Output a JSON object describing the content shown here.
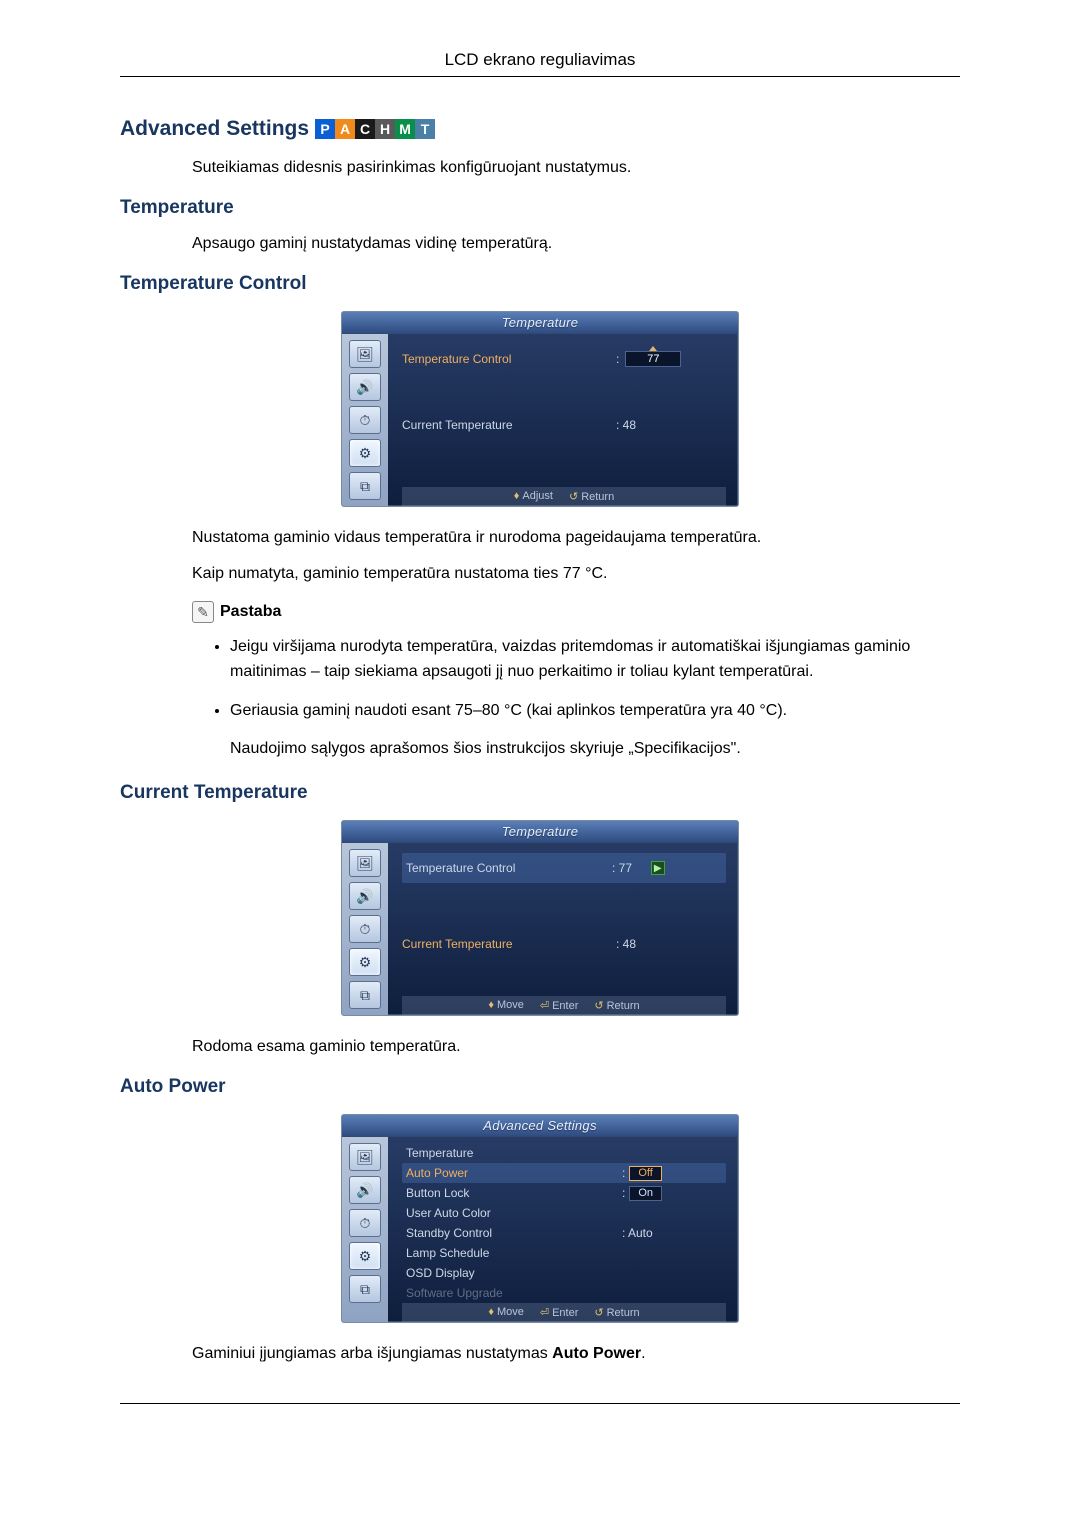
{
  "page_header": "LCD ekrano reguliavimas",
  "adv_heading": "Advanced Settings",
  "mode_chips": {
    "p": "P",
    "a": "A",
    "c": "C",
    "h": "H",
    "m": "M",
    "t": "T"
  },
  "adv_desc": "Suteikiamas didesnis pasirinkimas konfigūruojant nustatymus.",
  "temp_heading": "Temperature",
  "temp_desc": "Apsaugo gaminį nustatydamas vidinę temperatūrą.",
  "temp_ctrl_heading": "Temperature Control",
  "osd1": {
    "title": "Temperature",
    "row1_label": "Temperature Control",
    "row1_value": "77",
    "row2_label": "Current Temperature",
    "row2_value": ": 48",
    "foot_adjust": "Adjust",
    "foot_return": "Return"
  },
  "temp_ctrl_para1": "Nustatoma gaminio vidaus temperatūra ir nurodoma pageidaujama temperatūra.",
  "temp_ctrl_para2": "Kaip numatyta, gaminio temperatūra nustatoma ties 77 °C.",
  "note_label": "Pastaba",
  "bullet1": "Jeigu viršijama nurodyta temperatūra, vaizdas pritemdomas ir automatiškai išjungiamas gaminio maitinimas – taip siekiama apsaugoti jį nuo perkaitimo ir toliau kylant temperatūrai.",
  "bullet2": "Geriausia gaminį naudoti esant 75–80 °C (kai aplinkos temperatūra yra 40 °C).",
  "bullet2_sub": "Naudojimo sąlygos aprašomos šios instrukcijos skyriuje „Specifikacijos\".",
  "curr_temp_heading": "Current Temperature",
  "osd2": {
    "title": "Temperature",
    "row1_label": "Temperature Control",
    "row1_value": ": 77",
    "row2_label": "Current Temperature",
    "row2_value": ": 48",
    "foot_move": "Move",
    "foot_enter": "Enter",
    "foot_return": "Return"
  },
  "curr_temp_para": "Rodoma esama gaminio temperatūra.",
  "auto_power_heading": "Auto Power",
  "osd3": {
    "title": "Advanced Settings",
    "items": [
      {
        "label": "Temperature",
        "value": ""
      },
      {
        "label": "Auto Power",
        "value": "Off",
        "hl": true,
        "sel": true
      },
      {
        "label": "Button Lock",
        "value": "On",
        "box": true
      },
      {
        "label": "User Auto Color",
        "value": ""
      },
      {
        "label": "Standby Control",
        "value": ": Auto"
      },
      {
        "label": "Lamp Schedule",
        "value": ""
      },
      {
        "label": "OSD Display",
        "value": ""
      },
      {
        "label": "Software Upgrade",
        "value": "",
        "dim": true
      }
    ],
    "foot_move": "Move",
    "foot_enter": "Enter",
    "foot_return": "Return"
  },
  "auto_power_para_pre": "Gaminiui įjungiamas arba išjungiamas nustatymas ",
  "auto_power_bold": "Auto Power",
  "auto_power_para_post": "."
}
